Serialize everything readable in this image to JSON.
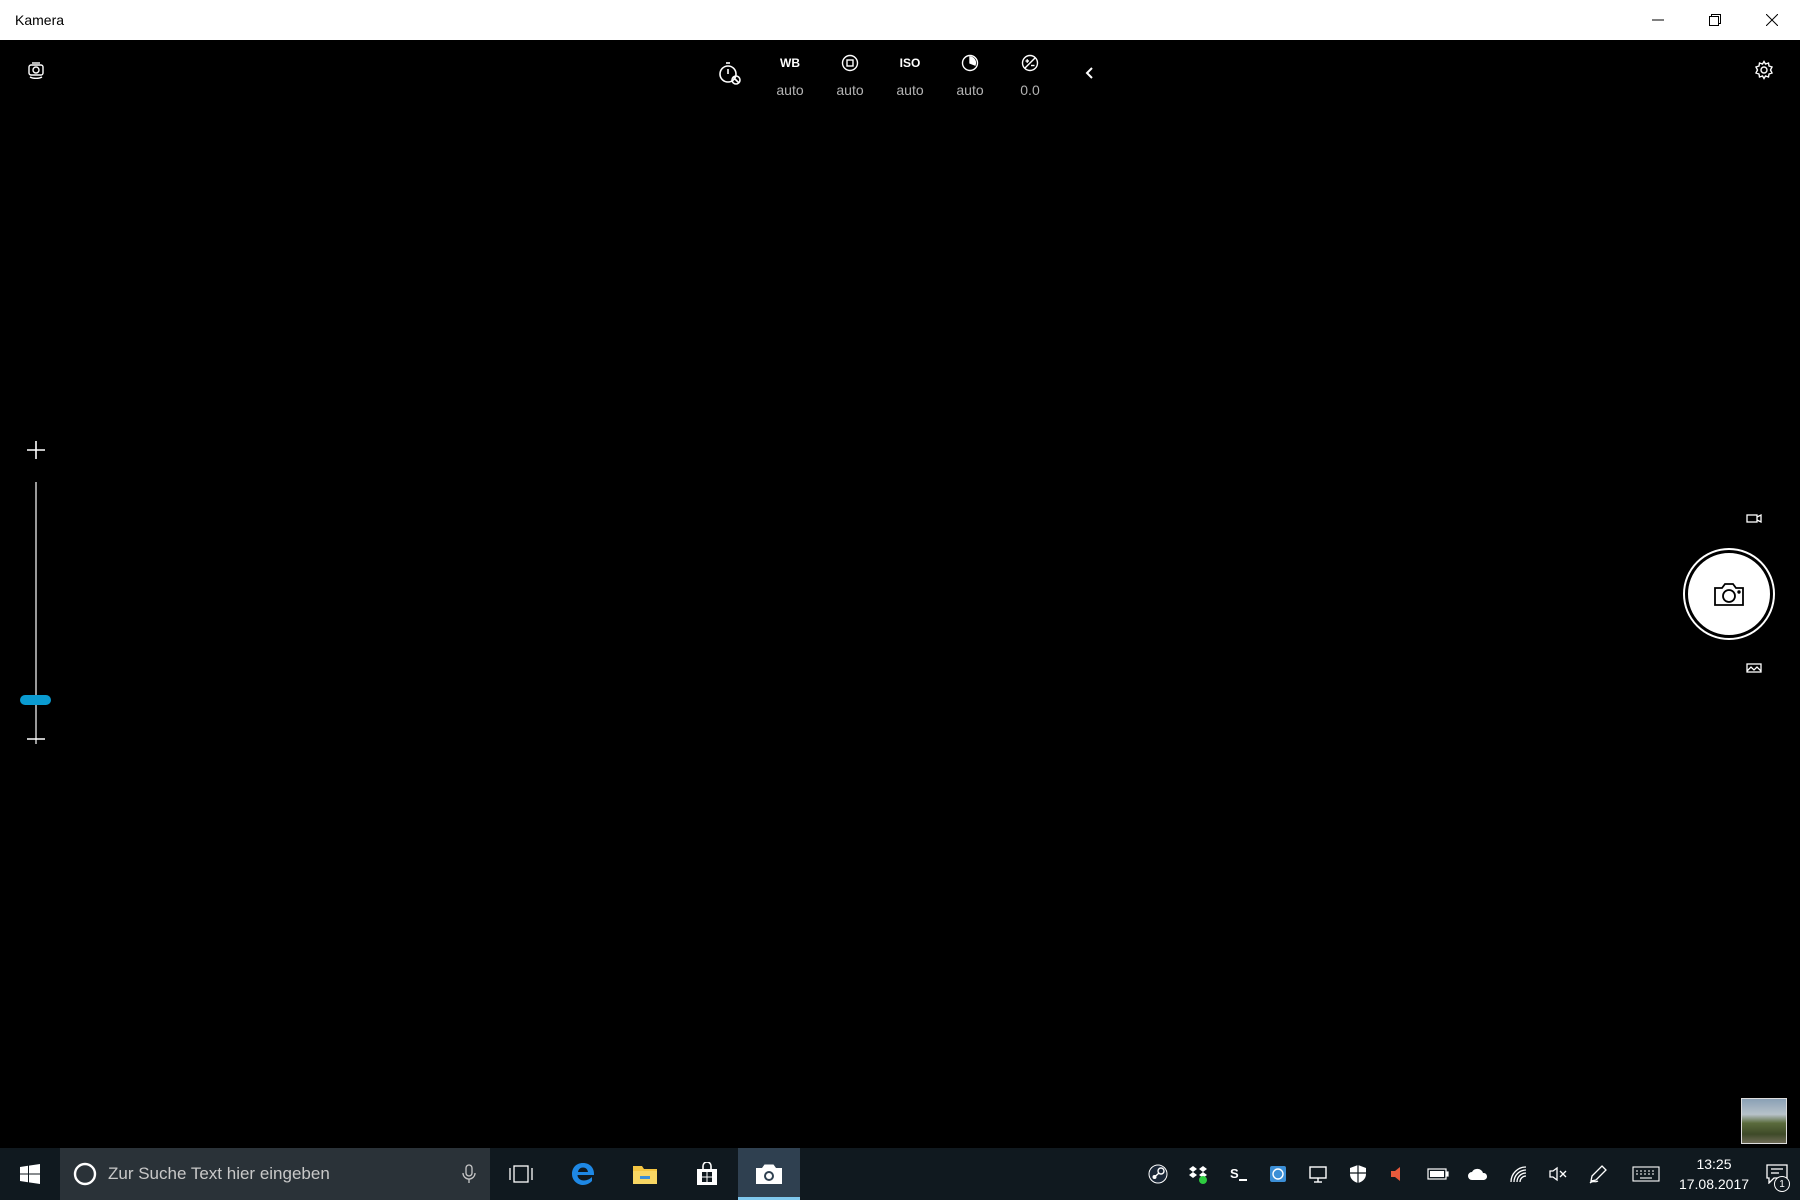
{
  "window": {
    "title": "Kamera",
    "minimize_icon": "minimize-icon",
    "restore_icon": "restore-icon",
    "close_icon": "close-icon"
  },
  "camera": {
    "photo_controls": [
      {
        "name": "timer",
        "icon": "timer-off-icon",
        "label": "",
        "value": ""
      },
      {
        "name": "white-balance",
        "icon": "",
        "label": "WB",
        "value": "auto"
      },
      {
        "name": "focus",
        "icon": "focus-icon",
        "label": "",
        "value": "auto"
      },
      {
        "name": "iso",
        "icon": "",
        "label": "ISO",
        "value": "auto"
      },
      {
        "name": "shutter-speed",
        "icon": "shutter-speed-icon",
        "label": "",
        "value": "auto"
      },
      {
        "name": "exposure",
        "icon": "exposure-icon",
        "label": "",
        "value": "0.0"
      }
    ],
    "zoom": {
      "level": 0
    },
    "accent": "#0a9bd1"
  },
  "taskbar": {
    "search_placeholder": "Zur Suche Text hier eingeben",
    "clock_time": "13:25",
    "clock_date": "17.08.2017",
    "notification_count": "1",
    "colors": {
      "background": "#10191f",
      "search": "#2a3238",
      "active_indicator": "#7fc8ee"
    }
  }
}
